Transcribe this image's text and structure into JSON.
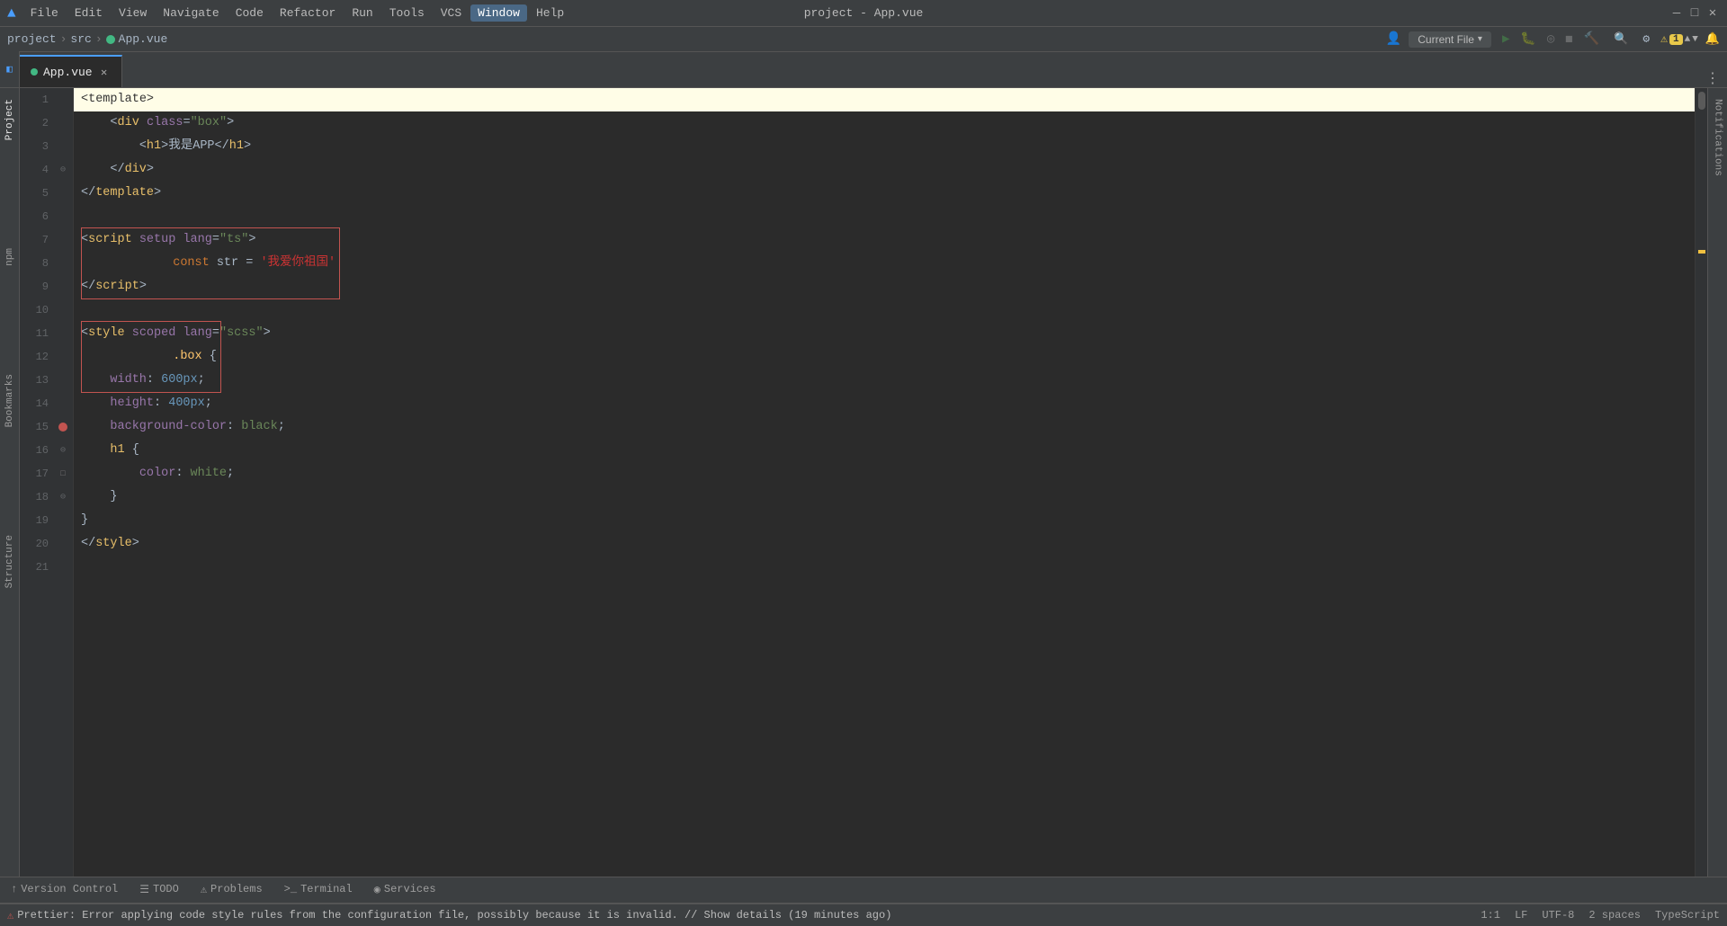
{
  "window": {
    "title": "project - App.vue",
    "logo": "▲"
  },
  "menubar": {
    "items": [
      {
        "label": "File",
        "active": false
      },
      {
        "label": "Edit",
        "active": false
      },
      {
        "label": "View",
        "active": false
      },
      {
        "label": "Navigate",
        "active": false
      },
      {
        "label": "Code",
        "active": false
      },
      {
        "label": "Refactor",
        "active": false
      },
      {
        "label": "Run",
        "active": false
      },
      {
        "label": "Tools",
        "active": false
      },
      {
        "label": "VCS",
        "active": false
      },
      {
        "label": "Window",
        "active": true
      },
      {
        "label": "Help",
        "active": false
      }
    ]
  },
  "breadcrumb": {
    "project": "project",
    "src": "src",
    "file": "App.vue",
    "vue_indicator": "●"
  },
  "toolbar": {
    "current_file_label": "Current File",
    "run_icon": "▶",
    "debug_icon": "🐛",
    "coverage_icon": "◎",
    "stop_icon": "◼",
    "build_icon": "🔨",
    "search_icon": "🔍",
    "settings_icon": "⚙",
    "user_icon": "👤"
  },
  "alert": {
    "count": "1",
    "icon": "⚠"
  },
  "tabs": [
    {
      "label": "App.vue",
      "active": true,
      "modified": false
    }
  ],
  "editor": {
    "lines": [
      {
        "num": 1,
        "tokens": [
          {
            "t": "angle",
            "v": "<"
          },
          {
            "t": "tag",
            "v": "template"
          },
          {
            "t": "angle",
            "v": ">"
          }
        ],
        "highlight": true,
        "gutter": ""
      },
      {
        "num": 2,
        "tokens": [
          {
            "t": "plain",
            "v": "    "
          },
          {
            "t": "angle",
            "v": "<"
          },
          {
            "t": "tag",
            "v": "div"
          },
          {
            "t": "plain",
            "v": " "
          },
          {
            "t": "attr",
            "v": "class"
          },
          {
            "t": "plain",
            "v": "="
          },
          {
            "t": "str",
            "v": "\"box\""
          },
          {
            "t": "angle",
            "v": ">"
          }
        ],
        "highlight": false,
        "gutter": ""
      },
      {
        "num": 3,
        "tokens": [
          {
            "t": "plain",
            "v": "        "
          },
          {
            "t": "angle",
            "v": "<"
          },
          {
            "t": "tag",
            "v": "h1"
          },
          {
            "t": "angle",
            "v": ">"
          },
          {
            "t": "plain",
            "v": "我是APP"
          },
          {
            "t": "angle",
            "v": "</"
          },
          {
            "t": "tag",
            "v": "h1"
          },
          {
            "t": "angle",
            "v": ">"
          }
        ],
        "highlight": false,
        "gutter": ""
      },
      {
        "num": 4,
        "tokens": [
          {
            "t": "plain",
            "v": "    "
          },
          {
            "t": "angle",
            "v": "</"
          },
          {
            "t": "tag",
            "v": "div"
          },
          {
            "t": "angle",
            "v": ">"
          }
        ],
        "highlight": false,
        "gutter": "fold"
      },
      {
        "num": 5,
        "tokens": [
          {
            "t": "angle",
            "v": "</"
          },
          {
            "t": "tag",
            "v": "template"
          },
          {
            "t": "angle",
            "v": ">"
          }
        ],
        "highlight": false,
        "gutter": ""
      },
      {
        "num": 6,
        "tokens": [],
        "highlight": false,
        "gutter": ""
      },
      {
        "num": 7,
        "tokens": [
          {
            "t": "angle",
            "v": "<"
          },
          {
            "t": "tag",
            "v": "script"
          },
          {
            "t": "plain",
            "v": " "
          },
          {
            "t": "attr",
            "v": "setup"
          },
          {
            "t": "plain",
            "v": " "
          },
          {
            "t": "attr",
            "v": "lang"
          },
          {
            "t": "plain",
            "v": "="
          },
          {
            "t": "str",
            "v": "\"ts\""
          },
          {
            "t": "angle",
            "v": ">"
          }
        ],
        "highlight": false,
        "gutter": ""
      },
      {
        "num": 8,
        "tokens": [
          {
            "t": "kw",
            "v": "const"
          },
          {
            "t": "plain",
            "v": " "
          },
          {
            "t": "plain",
            "v": "str"
          },
          {
            "t": "plain",
            "v": " = "
          },
          {
            "t": "str-red",
            "v": "'我爱你祖国'"
          }
        ],
        "highlight": false,
        "gutter": "",
        "error": true
      },
      {
        "num": 9,
        "tokens": [
          {
            "t": "angle",
            "v": "</"
          },
          {
            "t": "tag",
            "v": "script"
          },
          {
            "t": "angle",
            "v": ">"
          }
        ],
        "highlight": false,
        "gutter": ""
      },
      {
        "num": 10,
        "tokens": [],
        "highlight": false,
        "gutter": ""
      },
      {
        "num": 11,
        "tokens": [
          {
            "t": "angle",
            "v": "<"
          },
          {
            "t": "tag",
            "v": "style"
          },
          {
            "t": "plain",
            "v": " "
          },
          {
            "t": "attr",
            "v": "scoped"
          },
          {
            "t": "plain",
            "v": " "
          },
          {
            "t": "attr",
            "v": "lang"
          },
          {
            "t": "plain",
            "v": "="
          },
          {
            "t": "str",
            "v": "\"scss\""
          },
          {
            "t": "angle",
            "v": ">"
          }
        ],
        "highlight": false,
        "gutter": ""
      },
      {
        "num": 12,
        "tokens": [
          {
            "t": "class-name",
            "v": ".box"
          },
          {
            "t": "plain",
            "v": " {"
          }
        ],
        "highlight": false,
        "gutter": "",
        "error": true
      },
      {
        "num": 13,
        "tokens": [
          {
            "t": "plain",
            "v": "    "
          },
          {
            "t": "css-prop",
            "v": "width"
          },
          {
            "t": "plain",
            "v": ": "
          },
          {
            "t": "css-val",
            "v": "600px"
          },
          {
            "t": "plain",
            "v": ";"
          }
        ],
        "highlight": false,
        "gutter": ""
      },
      {
        "num": 14,
        "tokens": [
          {
            "t": "plain",
            "v": "    "
          },
          {
            "t": "css-prop",
            "v": "height"
          },
          {
            "t": "plain",
            "v": ": "
          },
          {
            "t": "css-val",
            "v": "400px"
          },
          {
            "t": "plain",
            "v": ";"
          }
        ],
        "highlight": false,
        "gutter": ""
      },
      {
        "num": 15,
        "tokens": [
          {
            "t": "plain",
            "v": "    "
          },
          {
            "t": "css-prop",
            "v": "background-color"
          },
          {
            "t": "plain",
            "v": ": "
          },
          {
            "t": "css-color",
            "v": "black"
          },
          {
            "t": "plain",
            "v": ";"
          }
        ],
        "highlight": false,
        "gutter": "breakpoint"
      },
      {
        "num": 16,
        "tokens": [
          {
            "t": "plain",
            "v": "    "
          },
          {
            "t": "tag",
            "v": "h1"
          },
          {
            "t": "plain",
            "v": " {"
          }
        ],
        "highlight": false,
        "gutter": "fold"
      },
      {
        "num": 17,
        "tokens": [
          {
            "t": "plain",
            "v": "        "
          },
          {
            "t": "css-prop",
            "v": "color"
          },
          {
            "t": "plain",
            "v": ": "
          },
          {
            "t": "css-color",
            "v": "white"
          },
          {
            "t": "plain",
            "v": ";"
          }
        ],
        "highlight": false,
        "gutter": "checkbox"
      },
      {
        "num": 18,
        "tokens": [
          {
            "t": "plain",
            "v": "    "
          },
          {
            "t": "plain",
            "v": "}"
          }
        ],
        "highlight": false,
        "gutter": "fold"
      },
      {
        "num": 19,
        "tokens": [
          {
            "t": "plain",
            "v": "}"
          }
        ],
        "highlight": false,
        "gutter": ""
      },
      {
        "num": 20,
        "tokens": [
          {
            "t": "angle",
            "v": "</"
          },
          {
            "t": "tag",
            "v": "style"
          },
          {
            "t": "angle",
            "v": ">"
          }
        ],
        "highlight": false,
        "gutter": ""
      },
      {
        "num": 21,
        "tokens": [],
        "highlight": false,
        "gutter": ""
      }
    ]
  },
  "bottom_tabs": [
    {
      "label": "Version Control",
      "icon": "↑",
      "active": false
    },
    {
      "label": "TODO",
      "icon": "☰",
      "active": false
    },
    {
      "label": "Problems",
      "icon": "⚠",
      "active": false
    },
    {
      "label": "Terminal",
      "icon": ">_",
      "active": false
    },
    {
      "label": "Services",
      "icon": "◉",
      "active": false
    }
  ],
  "status_bar": {
    "error_icon": "⚠",
    "error_count": "Prettier: Error applying code style rules from the configuration file, possibly because it is invalid. // Show details (19 minutes ago)",
    "position": "1:1",
    "line_ending": "LF",
    "encoding": "UTF-8",
    "indent": "2 spaces",
    "language": "TypeScript"
  },
  "left_panel": {
    "tabs": [
      "Project",
      "npm",
      "Bookmarks",
      "Structure"
    ]
  },
  "right_panel": {
    "tabs": [
      "Notifications"
    ]
  }
}
